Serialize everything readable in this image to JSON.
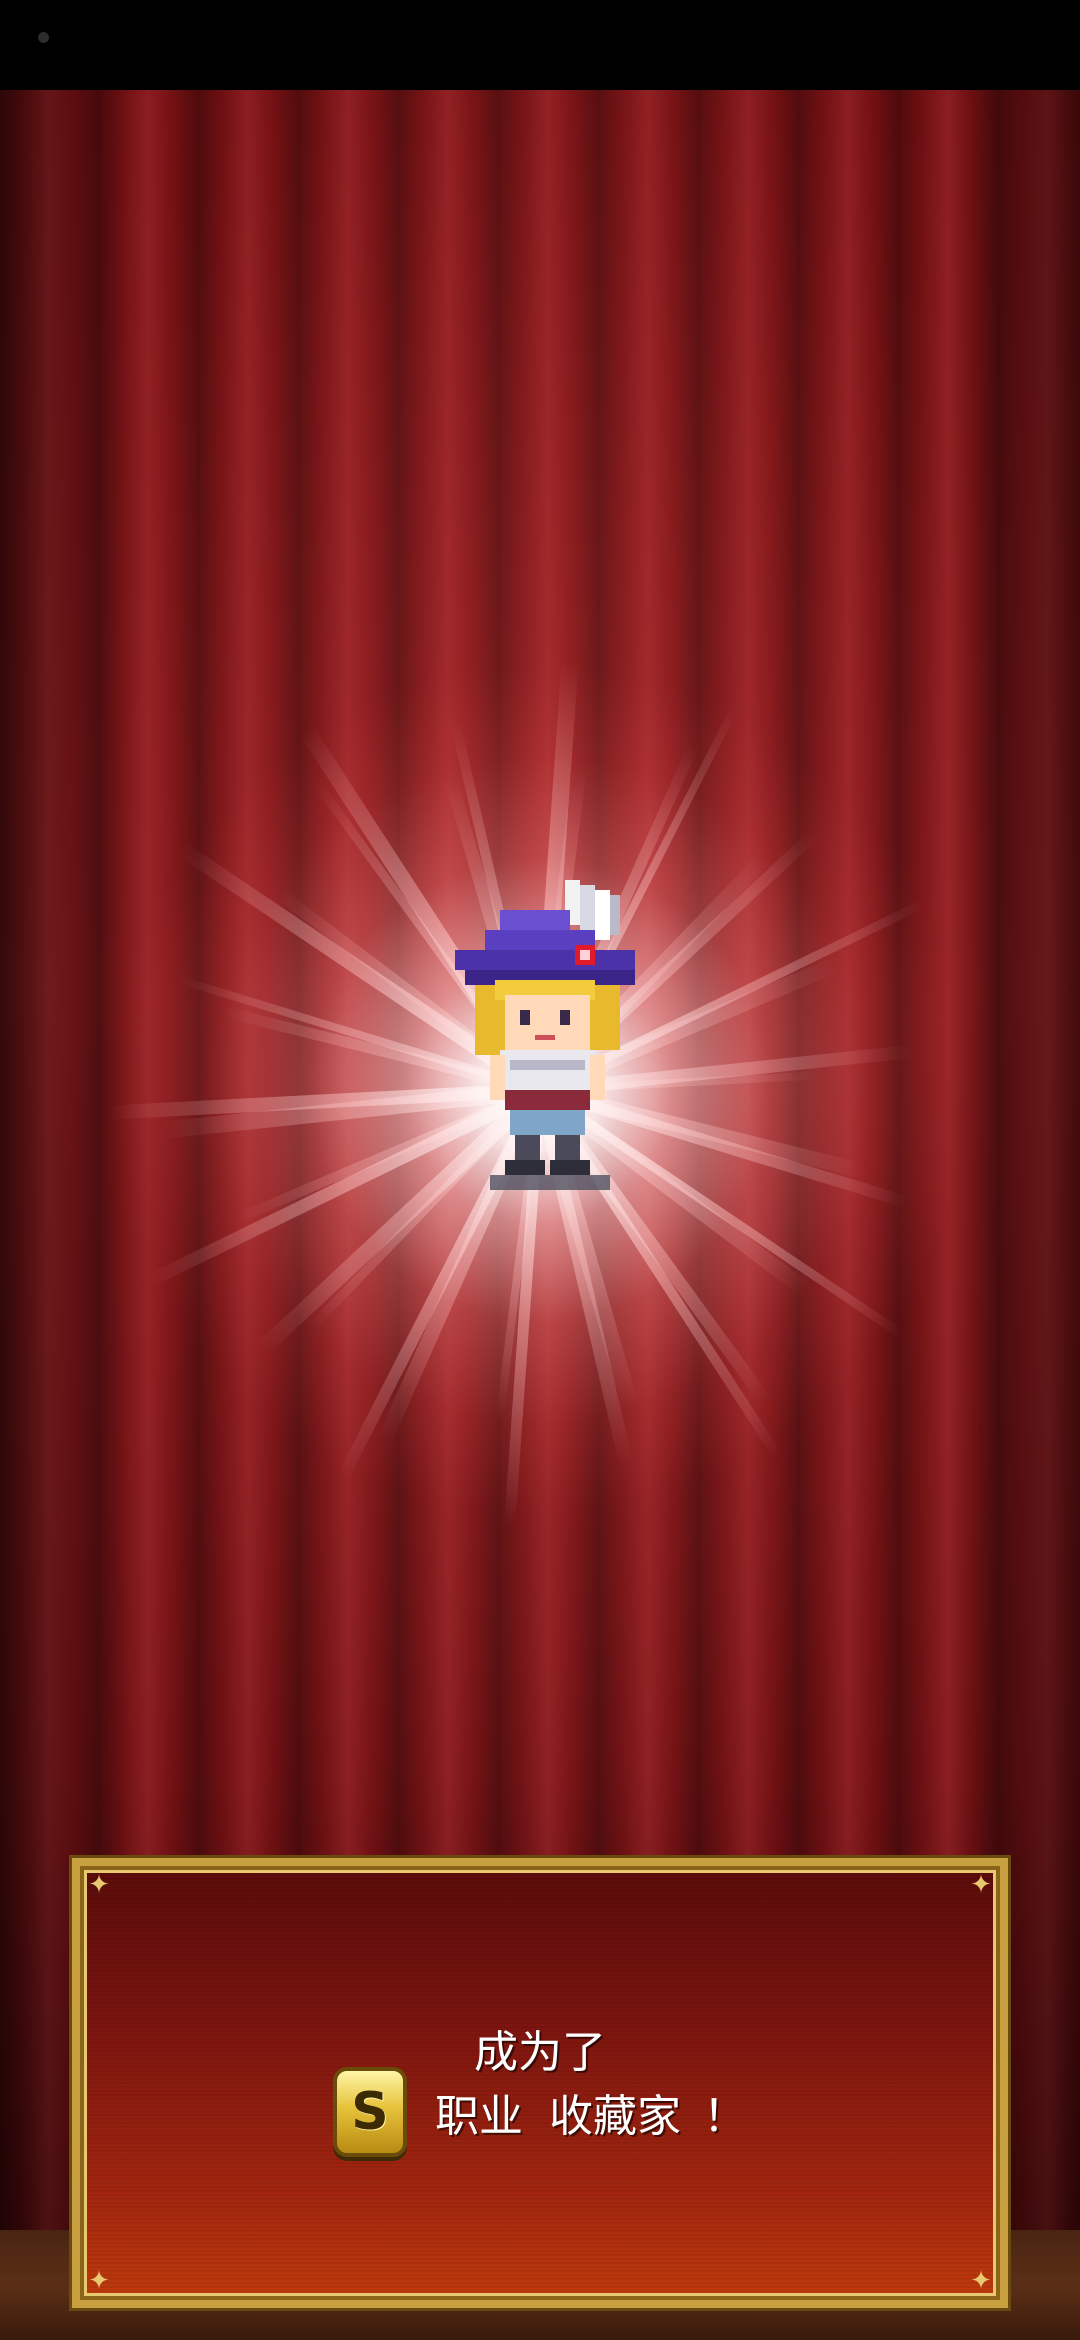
{
  "dialog": {
    "line1": "成为了",
    "rank_badge": "S",
    "job_label": "职业",
    "job_name": "收藏家",
    "exclamation": "！"
  },
  "icons": {
    "rank": "rank-s-badge-icon",
    "hero": "collector-hero-sprite",
    "burst": "light-burst"
  },
  "colors": {
    "curtain": "#8c1a1d",
    "frame_gold": "#c9a040",
    "dialog_fill": "#a3260f",
    "text": "#ffffff"
  }
}
